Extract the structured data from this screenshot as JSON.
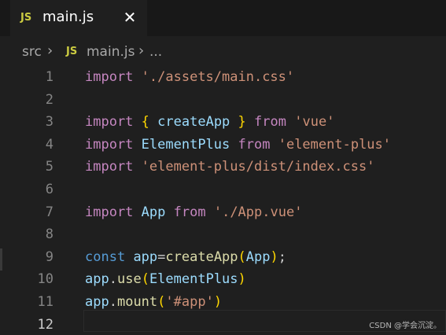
{
  "tab": {
    "icon": "js-file-icon",
    "icon_text": "JS",
    "title": "main.js",
    "close_glyph": "✕"
  },
  "breadcrumb": {
    "folder": "src",
    "file_icon_text": "JS",
    "file": "main.js",
    "more": "..."
  },
  "editor": {
    "active_line": 12,
    "lines": [
      {
        "num": "1"
      },
      {
        "num": "2"
      },
      {
        "num": "3"
      },
      {
        "num": "4"
      },
      {
        "num": "5"
      },
      {
        "num": "6"
      },
      {
        "num": "7"
      },
      {
        "num": "8"
      },
      {
        "num": "9"
      },
      {
        "num": "10"
      },
      {
        "num": "11"
      },
      {
        "num": "12"
      }
    ],
    "tokens": {
      "l1": [
        "import",
        " ",
        "'./assets/main.css'"
      ],
      "l3": [
        "import",
        " ",
        "{",
        " ",
        "createApp",
        " ",
        "}",
        " ",
        "from",
        " ",
        "'vue'"
      ],
      "l4": [
        "import",
        " ",
        "ElementPlus",
        " ",
        "from",
        " ",
        "'element-plus'"
      ],
      "l5": [
        "import",
        " ",
        "'element-plus/dist/index.css'"
      ],
      "l7": [
        "import",
        " ",
        "App",
        " ",
        "from",
        " ",
        "'./App.vue'"
      ],
      "l9": [
        "const",
        " ",
        "app",
        "=",
        "createApp",
        "(",
        "App",
        ")",
        ";"
      ],
      "l10": [
        "app",
        ".",
        "use",
        "(",
        "ElementPlus",
        ")"
      ],
      "l11": [
        "app",
        ".",
        "mount",
        "(",
        "'#app'",
        ")"
      ]
    }
  },
  "watermark": "CSDN @学会沉淀。",
  "colors": {
    "keyword": "#c586c0",
    "string": "#ce9178",
    "function": "#dcdcaa",
    "variable": "#9cdcfe",
    "storage": "#569cd6",
    "bracket_gold": "#ffd700",
    "bracket_purple": "#da70d6",
    "js_icon": "#cbcb41"
  }
}
